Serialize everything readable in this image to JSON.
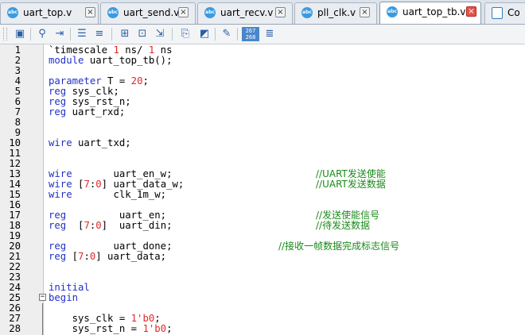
{
  "tabs": [
    {
      "label": "uart_top.v",
      "active": false
    },
    {
      "label": "uart_send.v",
      "active": false
    },
    {
      "label": "uart_recv.v",
      "active": false
    },
    {
      "label": "pll_clk.v",
      "active": false
    },
    {
      "label": "uart_top_tb.v",
      "active": true
    },
    {
      "label": "Co",
      "active": false
    }
  ],
  "toolbar": {
    "line_counter": "267\n268"
  },
  "editor": {
    "lines": [
      {
        "n": "1",
        "code": "`timescale 1 ns/ 1 ns"
      },
      {
        "n": "2",
        "code": "module uart_top_tb();"
      },
      {
        "n": "3",
        "code": ""
      },
      {
        "n": "4",
        "code": "parameter T = 20;"
      },
      {
        "n": "5",
        "code": "reg sys_clk;"
      },
      {
        "n": "6",
        "code": "reg sys_rst_n;"
      },
      {
        "n": "7",
        "code": "reg uart_rxd;"
      },
      {
        "n": "8",
        "code": ""
      },
      {
        "n": "9",
        "code": ""
      },
      {
        "n": "10",
        "code": "wire uart_txd;"
      },
      {
        "n": "11",
        "code": ""
      },
      {
        "n": "12",
        "code": ""
      },
      {
        "n": "13",
        "code": "wire       uart_en_w;",
        "comment": "//UART发送使能"
      },
      {
        "n": "14",
        "code": "wire [7:0] uart_data_w;",
        "comment": "//UART发送数据"
      },
      {
        "n": "15",
        "code": "wire       clk_1m_w;"
      },
      {
        "n": "16",
        "code": ""
      },
      {
        "n": "17",
        "code": "reg         uart_en;",
        "comment": "//发送使能信号"
      },
      {
        "n": "18",
        "code": "reg  [7:0]  uart_din;",
        "comment": "//待发送数据"
      },
      {
        "n": "19",
        "code": ""
      },
      {
        "n": "20",
        "code": "reg        uart_done;",
        "comment": "//接收一帧数据完成标志信号"
      },
      {
        "n": "21",
        "code": "reg [7:0] uart_data;"
      },
      {
        "n": "22",
        "code": ""
      },
      {
        "n": "23",
        "code": ""
      },
      {
        "n": "24",
        "code": "initial"
      },
      {
        "n": "25",
        "code": "begin"
      },
      {
        "n": "26",
        "code": ""
      },
      {
        "n": "27",
        "code": "    sys_clk = 1'b0;"
      },
      {
        "n": "28",
        "code": "    sys_rst_n = 1'b0;"
      }
    ]
  }
}
